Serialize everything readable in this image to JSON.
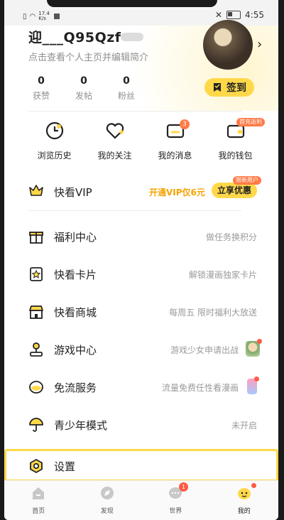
{
  "status_bar": {
    "network_speed": "17.4 K/s",
    "time": "4:55"
  },
  "profile": {
    "username": "迎___Q95Qzf",
    "bio": "点击查看个人主页并编辑简介",
    "stats": [
      {
        "value": "0",
        "label": "获赞"
      },
      {
        "value": "0",
        "label": "发帖"
      },
      {
        "value": "0",
        "label": "粉丝"
      }
    ],
    "signin_label": "签到"
  },
  "quick_actions": [
    {
      "label": "浏览历史",
      "icon": "clock-icon",
      "badge": ""
    },
    {
      "label": "我的关注",
      "icon": "heart-plus-icon",
      "badge": ""
    },
    {
      "label": "我的消息",
      "icon": "message-icon",
      "badge": "3"
    },
    {
      "label": "我的钱包",
      "icon": "wallet-icon",
      "badge": "首充返利"
    }
  ],
  "vip": {
    "title": "快看VIP",
    "promo": "开通VIP仅6元",
    "button": "立享优惠",
    "tag": "限新用户"
  },
  "menu": [
    {
      "title": "福利中心",
      "desc": "做任务换积分",
      "icon": "gift-icon"
    },
    {
      "title": "快看卡片",
      "desc": "解锁漫画独家卡片",
      "icon": "card-star-icon"
    },
    {
      "title": "快看商城",
      "desc": "每周五 限时福利大放送",
      "icon": "store-icon"
    },
    {
      "title": "游戏中心",
      "desc": "游戏少女申请出战",
      "icon": "joystick-icon"
    },
    {
      "title": "免流服务",
      "desc": "流量免费任性看漫画",
      "icon": "data-free-icon"
    },
    {
      "title": "青少年模式",
      "desc": "未开启",
      "icon": "umbrella-icon"
    },
    {
      "title": "设置",
      "desc": "",
      "icon": "settings-hexagon-icon"
    }
  ],
  "tabs": [
    {
      "label": "首页",
      "icon": "home-icon",
      "badge": ""
    },
    {
      "label": "发现",
      "icon": "discover-icon",
      "badge": ""
    },
    {
      "label": "世界",
      "icon": "world-chat-icon",
      "badge": "1"
    },
    {
      "label": "我的",
      "icon": "mine-face-icon",
      "badge": ""
    }
  ],
  "colors": {
    "accent": "#ffd84a",
    "badge": "#ff7a45",
    "promo_text": "#f4a300"
  }
}
